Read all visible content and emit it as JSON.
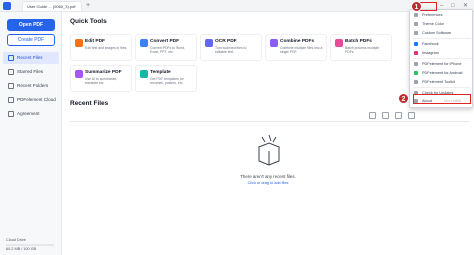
{
  "titlebar": {
    "tab_title": "User Guide ... (0060_3).pdf",
    "add_tab": "+",
    "minimize": "–",
    "maximize": "□",
    "close": "✕"
  },
  "sidebar": {
    "open_pdf": "Open PDF",
    "create_pdf": "Create PDF",
    "items": [
      {
        "label": "Recent Files",
        "icon": "clock-icon"
      },
      {
        "label": "Starred Files",
        "icon": "star-icon"
      },
      {
        "label": "Recent Folders",
        "icon": "folder-icon"
      },
      {
        "label": "PDFelement Cloud",
        "icon": "cloud-icon"
      },
      {
        "label": "Agreement",
        "icon": "agreement-icon"
      }
    ],
    "cloud_drive": "Cloud Drive",
    "cloud_usage": "60.2 MB / 100 GB"
  },
  "quick_tools": {
    "title": "Quick Tools",
    "tools": [
      {
        "title": "Edit PDF",
        "desc": "Edit text and images in files.",
        "color": "#f97316"
      },
      {
        "title": "Convert PDF",
        "desc": "Convert PDFs to Word, Excel, PPT, etc.",
        "color": "#3b82f6"
      },
      {
        "title": "OCR PDF",
        "desc": "Turn scanned files to editable text.",
        "color": "#6366f1"
      },
      {
        "title": "Combine PDFs",
        "desc": "Combine multiple files into a single PDF.",
        "color": "#8b5cf6"
      },
      {
        "title": "Batch PDFs",
        "desc": "Batch process multiple PDFs.",
        "color": "#ec4899"
      },
      {
        "title": "Summarize PDF",
        "desc": "Use AI to summarize, translate etc.",
        "color": "#a855f7"
      },
      {
        "title": "Template",
        "desc": "Get PDF templates for resumes, posters, etc.",
        "color": "#14b8a6"
      }
    ]
  },
  "recent": {
    "title": "Recent Files",
    "empty_message": "There aren't any recent files.",
    "empty_hint": "Click or drag to add files"
  },
  "menu": {
    "items": [
      {
        "label": "Preferences",
        "icon": "settings-icon"
      },
      {
        "label": "Theme Color",
        "icon": "palette-icon"
      },
      {
        "label": "Custom Software",
        "icon": "software-icon"
      },
      {
        "label": "Facebook",
        "icon": "facebook-icon"
      },
      {
        "label": "Instagram",
        "icon": "instagram-icon"
      },
      {
        "label": "PDFelement for iPhone",
        "icon": "phone-icon"
      },
      {
        "label": "PDFelement for Android",
        "icon": "android-icon"
      },
      {
        "label": "PDFelement Toolkit",
        "icon": "toolkit-icon"
      },
      {
        "label": "Check for Updates",
        "icon": "update-icon"
      },
      {
        "label": "About",
        "icon": "info-icon"
      }
    ],
    "version": "10.x.x (x64)"
  },
  "annotations": {
    "step1": "1",
    "step2": "2",
    "color": "#c1272d"
  }
}
